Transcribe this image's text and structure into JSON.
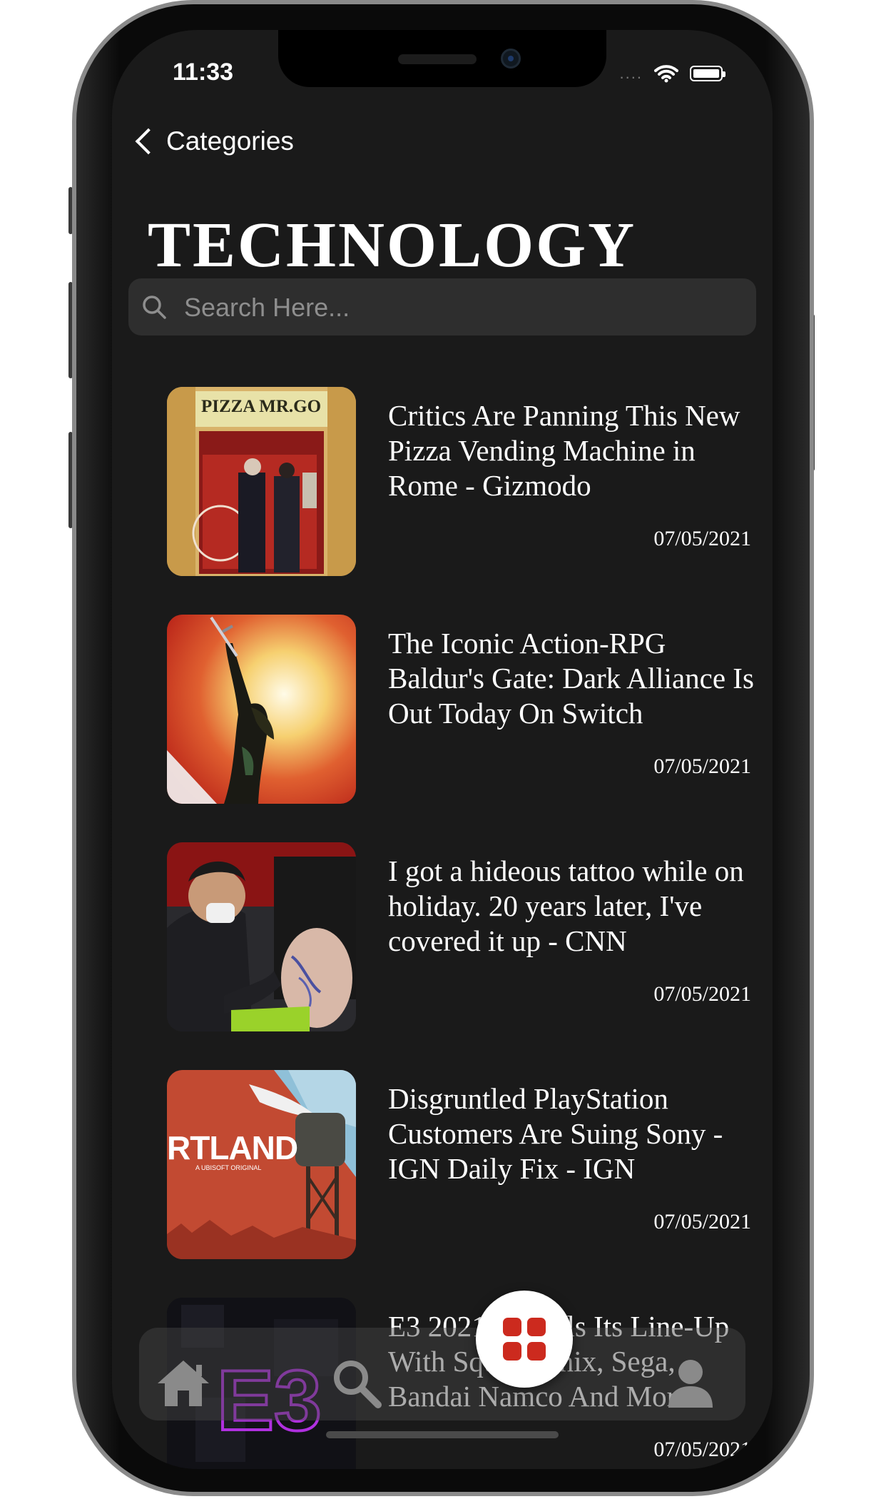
{
  "status_bar": {
    "time": "11:33",
    "signal": "....",
    "wifi_icon": "wifi-icon",
    "battery_icon": "battery-icon"
  },
  "nav": {
    "back_label": "Categories"
  },
  "page": {
    "title": "TECHNOLOGY"
  },
  "search": {
    "placeholder": "Search Here..."
  },
  "articles": [
    {
      "title": "Critics Are Panning This New Pizza Vending Machine in Rome - Gizmodo",
      "date": "07/05/2021",
      "thumb_text": "PIZZA MR.GO"
    },
    {
      "title": "The Iconic Action-RPG Baldur's Gate: Dark Alliance Is Out Today On Switch",
      "date": "07/05/2021"
    },
    {
      "title": "I got a hideous tattoo while on holiday. 20 years later, I've covered it up - CNN",
      "date": "07/05/2021"
    },
    {
      "title": "Disgruntled PlayStation Customers Are Suing Sony - IGN Daily Fix - IGN",
      "date": "07/05/2021",
      "thumb_text": "RTLAND",
      "thumb_sub": "A UBISOFT ORIGINAL"
    },
    {
      "title": "E3 2021 Reveals Its Line-Up With Square Enix, Sega, Bandai Namco And More",
      "date": "07/05/2021",
      "thumb_text": "E3"
    }
  ],
  "tabbar": {
    "items": [
      {
        "name": "home",
        "icon": "home-icon"
      },
      {
        "name": "search",
        "icon": "search-icon"
      },
      {
        "name": "categories",
        "icon": "grid-icon"
      },
      {
        "name": "profile",
        "icon": "user-icon"
      }
    ]
  },
  "colors": {
    "background": "#1a1a1a",
    "accent": "#cc2a1e",
    "text": "#ffffff",
    "search_bg": "#2e2e2e"
  }
}
